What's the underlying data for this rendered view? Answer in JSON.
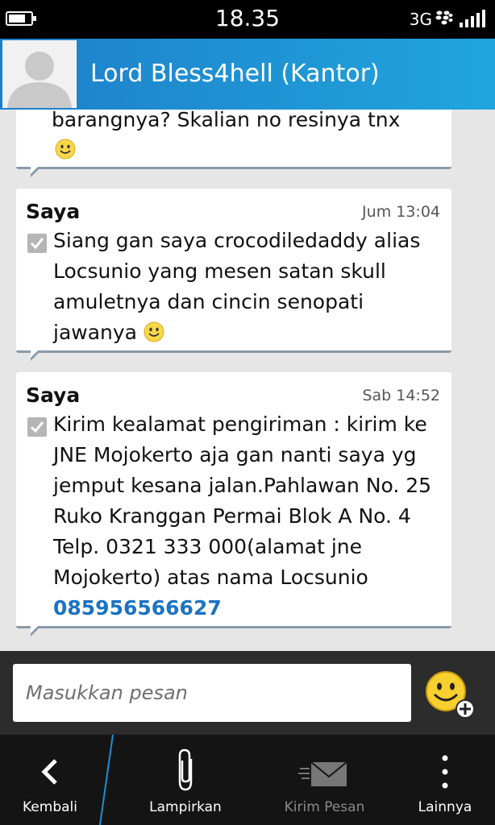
{
  "status_bar": {
    "time": "18.35",
    "network": "3G",
    "battery_level": 0.75
  },
  "header": {
    "contact_name": "Lord Bless4hell (Kantor)"
  },
  "messages": [
    {
      "sender": "",
      "time": "",
      "text": "barangnya? Skalian no resinya tnx",
      "emoji": "smiley"
    },
    {
      "sender": "Saya",
      "time": "Jum 13:04",
      "text": "Siang gan saya crocodiledaddy alias Locsunio yang mesen satan skull amuletnya dan cincin senopati jawanya",
      "emoji": "smiley",
      "delivered": true
    },
    {
      "sender": "Saya",
      "time": "Sab 14:52",
      "text": "Kirim kealamat pengiriman : kirim ke JNE Mojokerto aja gan nanti saya yg jemput kesana jalan.Pahlawan No. 25 Ruko Kranggan Permai Blok A No. 4 Telp. 0321 333 000(alamat jne Mojokerto) atas nama Locsunio",
      "phone": "085956566627",
      "delivered": true
    }
  ],
  "compose": {
    "placeholder": "Masukkan pesan"
  },
  "action_bar": {
    "back": "Kembali",
    "attach": "Lampirkan",
    "send": "Kirim Pesan",
    "more": "Lainnya"
  },
  "colors": {
    "header_accent": "#1e8fd5",
    "link": "#1b73c2",
    "action_bar_bg": "#141414"
  },
  "icons": [
    "battery-icon",
    "blackberry-icon",
    "signal-icon",
    "contact-avatar-icon",
    "check-icon",
    "smiley-icon",
    "emoji-add-icon",
    "back-chevron-icon",
    "paperclip-icon",
    "envelope-icon",
    "more-dots-icon"
  ]
}
